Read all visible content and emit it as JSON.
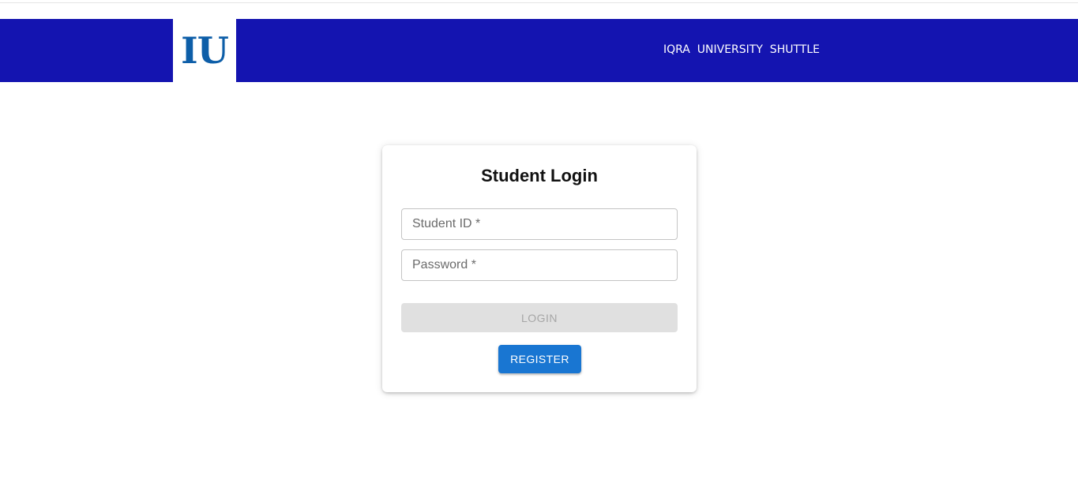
{
  "navbar": {
    "logo_text": "IU",
    "title": "IQRA  UNIVERSITY  SHUTTLE",
    "background_color": "#1414b0"
  },
  "login_card": {
    "title": "Student Login",
    "student_id_placeholder": "Student ID *",
    "student_id_value": "",
    "password_placeholder": "Password *",
    "password_value": "",
    "login_label": "LOGIN",
    "login_disabled": true,
    "register_label": "REGISTER",
    "accent_color": "#1976d2"
  }
}
